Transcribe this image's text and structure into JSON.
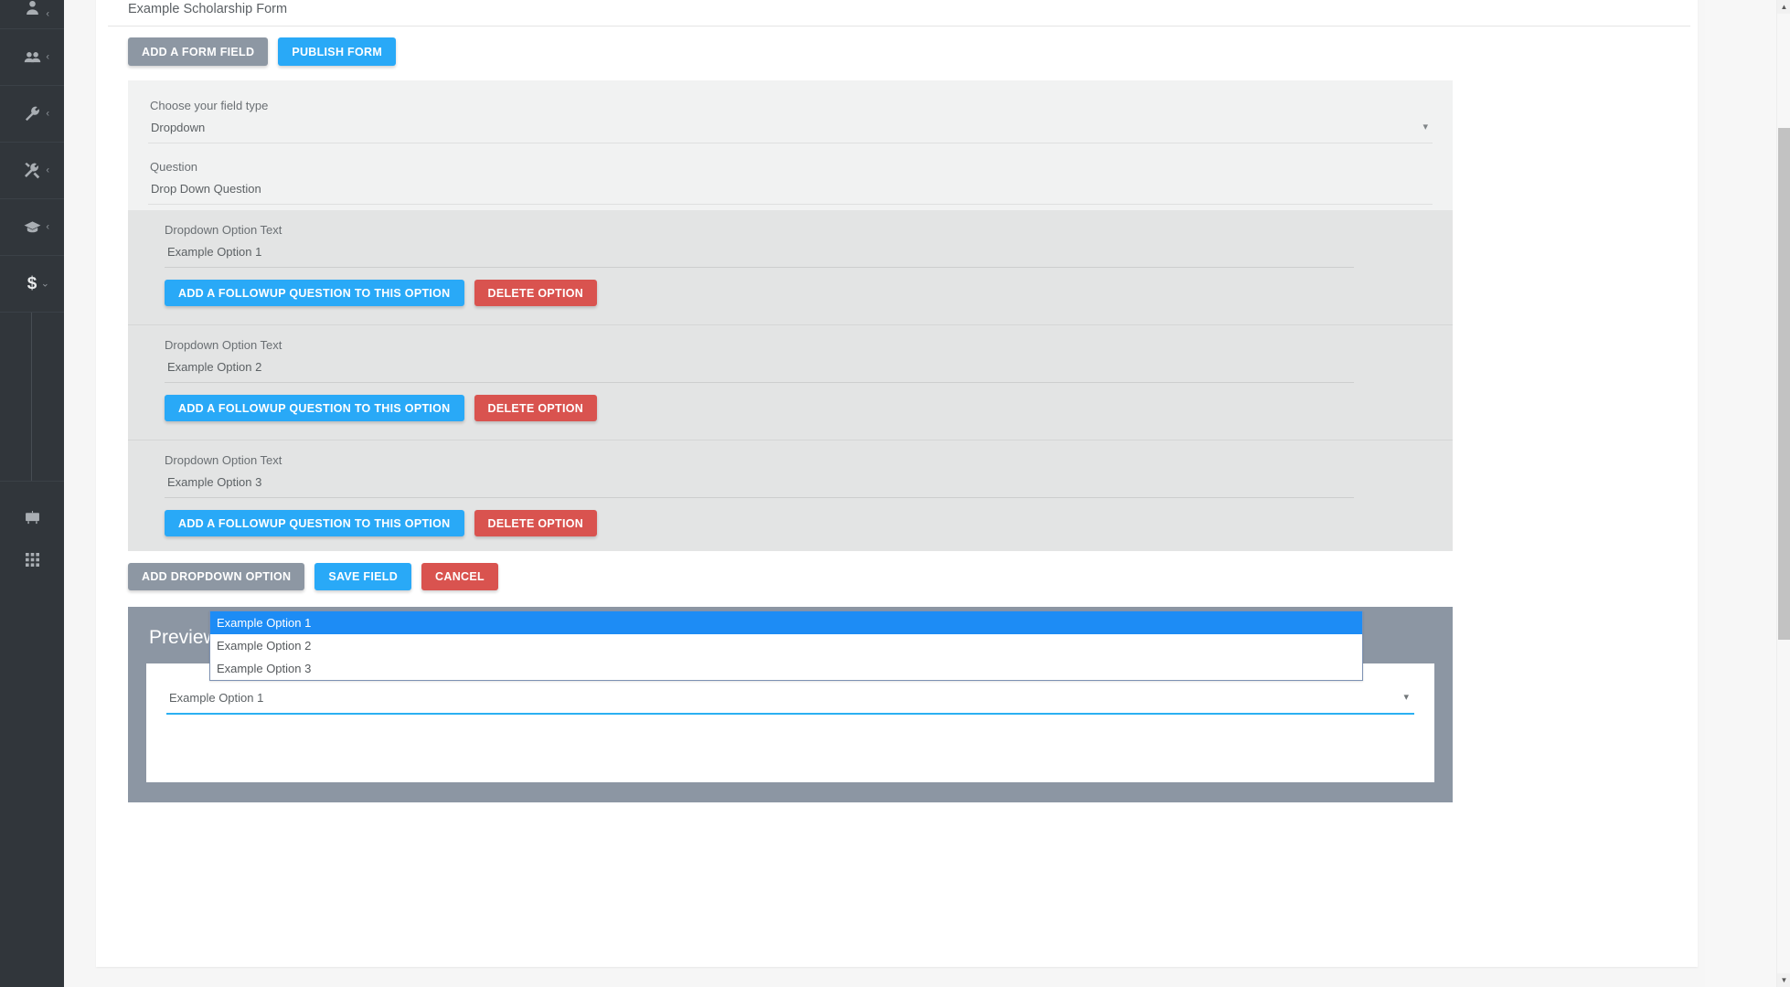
{
  "sidebar": {
    "items": [
      {
        "name": "user-icon",
        "label": "",
        "caret": "‹"
      },
      {
        "name": "people-icon",
        "label": "",
        "caret": "‹"
      },
      {
        "name": "wrench-icon",
        "label": "",
        "caret": "‹"
      },
      {
        "name": "tools-icon",
        "label": "",
        "caret": "‹"
      },
      {
        "name": "graduation-cap-icon",
        "label": "",
        "caret": "‹"
      },
      {
        "name": "dollar-icon",
        "label": "$",
        "caret": "⌄"
      }
    ],
    "bottom_items": [
      {
        "name": "presentation-board-icon"
      },
      {
        "name": "grid-apps-icon"
      }
    ]
  },
  "form": {
    "title": "Example Scholarship Form",
    "toolbar": {
      "add_field_label": "ADD A FORM FIELD",
      "publish_label": "PUBLISH FORM"
    },
    "field_type_label": "Choose your field type",
    "field_type_value": "Dropdown",
    "field_type_caret": "▾",
    "question_label": "Question",
    "question_value": "Drop Down Question",
    "options": [
      {
        "label": "Dropdown Option Text",
        "value": "Example Option 1",
        "followup_label": "ADD A FOLLOWUP QUESTION TO THIS OPTION",
        "delete_label": "DELETE OPTION"
      },
      {
        "label": "Dropdown Option Text",
        "value": "Example Option 2",
        "followup_label": "ADD A FOLLOWUP QUESTION TO THIS OPTION",
        "delete_label": "DELETE OPTION"
      },
      {
        "label": "Dropdown Option Text",
        "value": "Example Option 3",
        "followup_label": "ADD A FOLLOWUP QUESTION TO THIS OPTION",
        "delete_label": "DELETE OPTION"
      }
    ],
    "actions": {
      "add_option_label": "ADD DROPDOWN OPTION",
      "save_label": "SAVE FIELD",
      "cancel_label": "CANCEL"
    }
  },
  "preview": {
    "title": "Preview",
    "select_value": "Example Option 1",
    "select_caret": "▾",
    "dropdown_open": true,
    "dropdown_options": [
      {
        "label": "Example Option 1",
        "selected": true
      },
      {
        "label": "Example Option 2",
        "selected": false
      },
      {
        "label": "Example Option 3",
        "selected": false
      }
    ]
  },
  "scrollbar": {
    "up_arrow": "▲",
    "down_arrow": "▼"
  },
  "colors": {
    "sidebar_bg": "#31363b",
    "primary_blue": "#29a9f7",
    "grey_button": "#8d97a3",
    "red_button": "#d9534f",
    "preview_panel": "#8c96a3",
    "dropdown_highlight": "#1d8cf5"
  }
}
